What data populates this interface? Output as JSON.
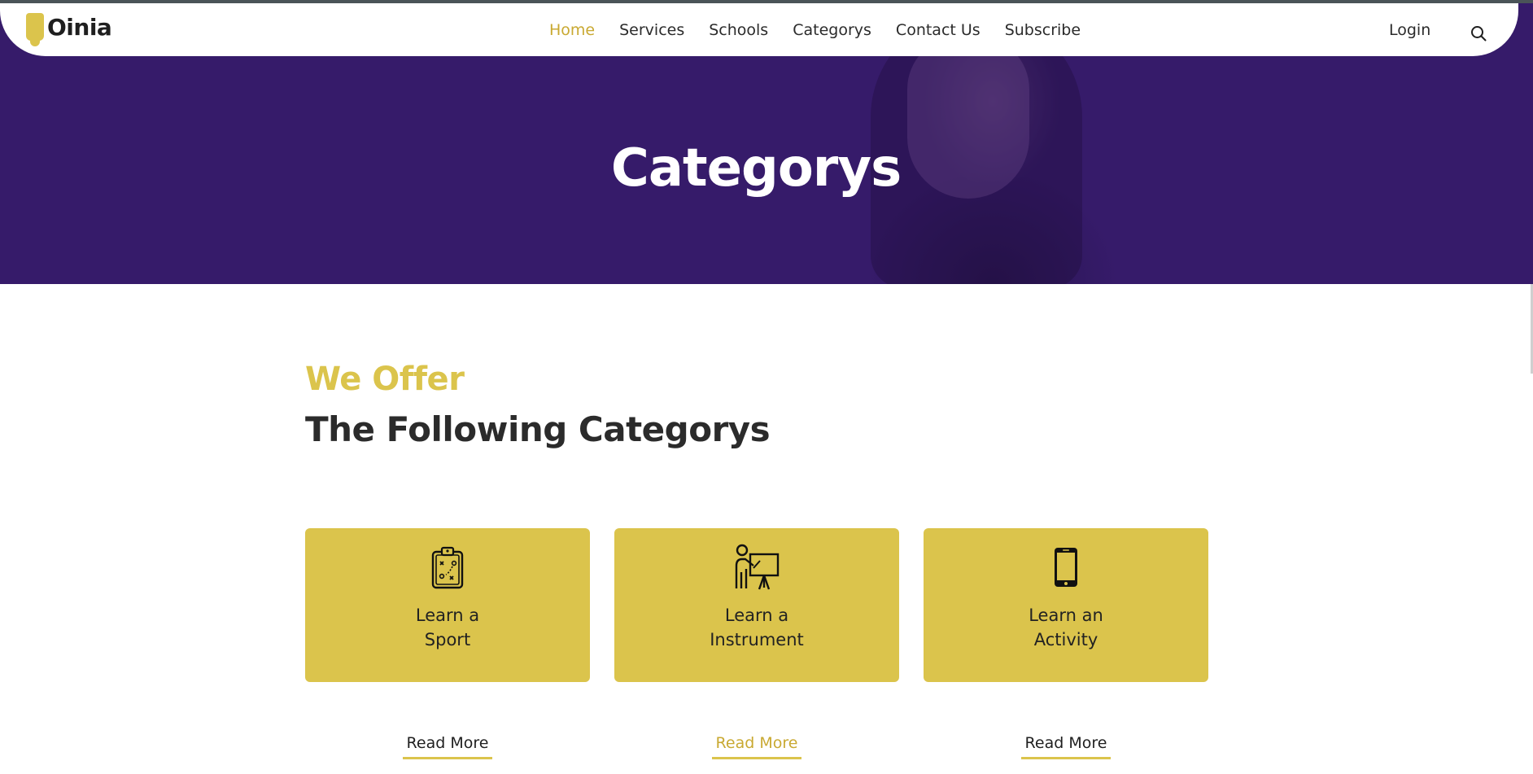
{
  "brand": {
    "name": "Oinia",
    "accent": "#dbc44c",
    "hero_bg": "#361b6a"
  },
  "nav": {
    "items": [
      {
        "label": "Home",
        "active": true
      },
      {
        "label": "Services",
        "active": false
      },
      {
        "label": "Schools",
        "active": false
      },
      {
        "label": "Categorys",
        "active": false
      },
      {
        "label": "Contact Us",
        "active": false
      },
      {
        "label": "Subscribe",
        "active": false
      }
    ],
    "login_label": "Login",
    "search_icon": "search-icon"
  },
  "hero": {
    "title": "Categorys"
  },
  "section": {
    "subtitle": "We Offer",
    "title": "The Following Categorys"
  },
  "cards": [
    {
      "icon": "clipboard-strategy-icon",
      "label": "Learn a\nSport",
      "read_more": "Read More"
    },
    {
      "icon": "teacher-presentation-icon",
      "label": "Learn a\nInstrument",
      "read_more": "Read More"
    },
    {
      "icon": "smartphone-icon",
      "label": "Learn an\nActivity",
      "read_more": "Read More"
    }
  ]
}
